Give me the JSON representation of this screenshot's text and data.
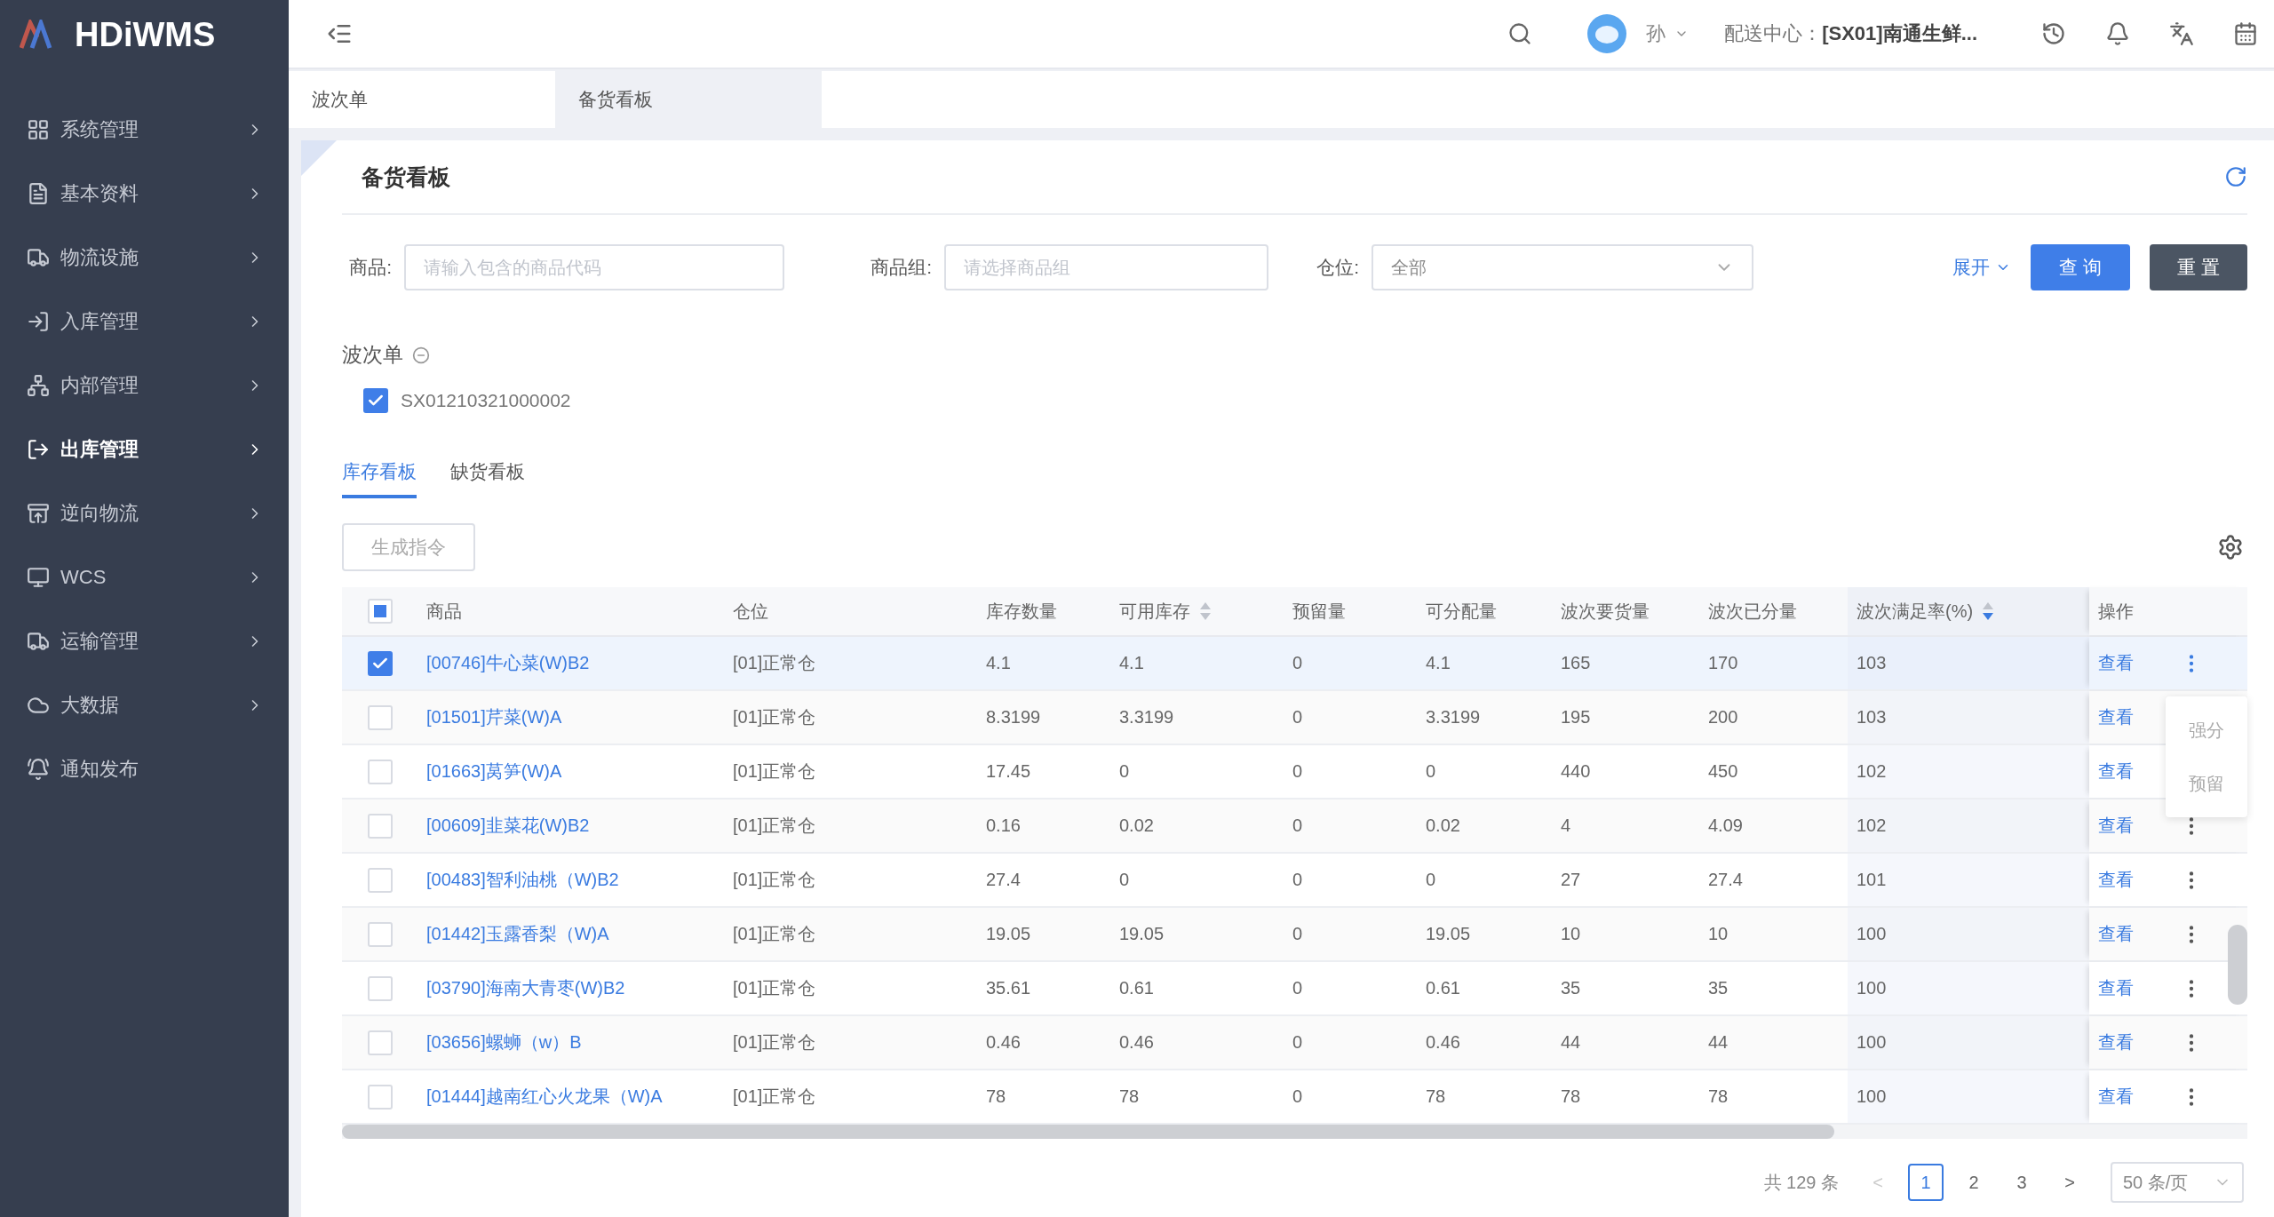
{
  "brand": {
    "name": "HDiWMS"
  },
  "sidebar": {
    "items": [
      {
        "label": "系统管理",
        "selected": false,
        "has_arrow": true
      },
      {
        "label": "基本资料",
        "selected": false,
        "has_arrow": true
      },
      {
        "label": "物流设施",
        "selected": false,
        "has_arrow": true
      },
      {
        "label": "入库管理",
        "selected": false,
        "has_arrow": true
      },
      {
        "label": "内部管理",
        "selected": false,
        "has_arrow": true
      },
      {
        "label": "出库管理",
        "selected": true,
        "has_arrow": true
      },
      {
        "label": "逆向物流",
        "selected": false,
        "has_arrow": true
      },
      {
        "label": "WCS",
        "selected": false,
        "has_arrow": true
      },
      {
        "label": "运输管理",
        "selected": false,
        "has_arrow": true
      },
      {
        "label": "大数据",
        "selected": false,
        "has_arrow": true
      },
      {
        "label": "通知发布",
        "selected": false,
        "has_arrow": false
      }
    ]
  },
  "header": {
    "user": "孙",
    "center_label": "配送中心：",
    "center_value": "[SX01]南通生鲜..."
  },
  "page_tabs": [
    {
      "label": "波次单",
      "selected": false
    },
    {
      "label": "备货看板",
      "selected": true
    }
  ],
  "card": {
    "title": "备货看板",
    "filters": [
      {
        "label": "商品:",
        "placeholder": "请输入包含的商品代码",
        "kind": "input"
      },
      {
        "label": "商品组:",
        "placeholder": "请选择商品组",
        "kind": "input"
      },
      {
        "label": "仓位:",
        "value": "全部",
        "kind": "select"
      }
    ],
    "expand_link": "展开",
    "query_button": "查 询",
    "reset_button": "重 置",
    "wave": {
      "label": "波次单",
      "items": [
        {
          "label": "SX01210321000002",
          "checked": true
        }
      ]
    },
    "tabs": [
      {
        "label": "库存看板",
        "selected": true
      },
      {
        "label": "缺货看板",
        "selected": false
      }
    ],
    "generate_button": "生成指令",
    "table": {
      "header_checkbox": {
        "indeterminate": true
      },
      "columns": [
        {
          "label": "商品"
        },
        {
          "label": "仓位"
        },
        {
          "label": "库存数量"
        },
        {
          "label": "可用库存",
          "sortable": true,
          "sorted_desc": false
        },
        {
          "label": "预留量"
        },
        {
          "label": "可分配量"
        },
        {
          "label": "波次要货量"
        },
        {
          "label": "波次已分量"
        },
        {
          "label": "波次满足率(%)",
          "sortable": true,
          "sorted_desc": true
        },
        {
          "label": "操作"
        }
      ],
      "rows": [
        {
          "selected": true,
          "menu_open": true,
          "cells": [
            "[00746]牛心菜(W)B2",
            "[01]正常仓",
            "4.1",
            "4.1",
            "0",
            "4.1",
            "165",
            "170",
            "103",
            "查看"
          ]
        },
        {
          "selected": false,
          "menu_open": false,
          "cells": [
            "[01501]芹菜(W)A",
            "[01]正常仓",
            "8.3199",
            "3.3199",
            "0",
            "3.3199",
            "195",
            "200",
            "103",
            "查看"
          ]
        },
        {
          "selected": false,
          "menu_open": false,
          "cells": [
            "[01663]莴笋(W)A",
            "[01]正常仓",
            "17.45",
            "0",
            "0",
            "0",
            "440",
            "450",
            "102",
            "查看"
          ]
        },
        {
          "selected": false,
          "menu_open": false,
          "cells": [
            "[00609]韭菜花(W)B2",
            "[01]正常仓",
            "0.16",
            "0.02",
            "0",
            "0.02",
            "4",
            "4.09",
            "102",
            "查看"
          ]
        },
        {
          "selected": false,
          "menu_open": false,
          "cells": [
            "[00483]智利油桃（W)B2",
            "[01]正常仓",
            "27.4",
            "0",
            "0",
            "0",
            "27",
            "27.4",
            "101",
            "查看"
          ]
        },
        {
          "selected": false,
          "menu_open": false,
          "cells": [
            "[01442]玉露香梨（W)A",
            "[01]正常仓",
            "19.05",
            "19.05",
            "0",
            "19.05",
            "10",
            "10",
            "100",
            "查看"
          ]
        },
        {
          "selected": false,
          "menu_open": false,
          "cells": [
            "[03790]海南大青枣(W)B2",
            "[01]正常仓",
            "35.61",
            "0.61",
            "0",
            "0.61",
            "35",
            "35",
            "100",
            "查看"
          ]
        },
        {
          "selected": false,
          "menu_open": false,
          "cells": [
            "[03656]螺蛳（w）B",
            "[01]正常仓",
            "0.46",
            "0.46",
            "0",
            "0.46",
            "44",
            "44",
            "100",
            "查看"
          ]
        },
        {
          "selected": false,
          "menu_open": false,
          "cells": [
            "[01444]越南红心火龙果（W)A",
            "[01]正常仓",
            "78",
            "78",
            "0",
            "78",
            "78",
            "78",
            "100",
            "查看"
          ]
        }
      ],
      "row_menu": [
        "强分",
        "预留"
      ]
    },
    "pagination": {
      "total": "共 129 条",
      "prev": "<",
      "pages": [
        {
          "label": "1",
          "selected": true
        },
        {
          "label": "2",
          "selected": false
        },
        {
          "label": "3",
          "selected": false
        }
      ],
      "next": ">",
      "page_size": "50 条/页"
    }
  }
}
